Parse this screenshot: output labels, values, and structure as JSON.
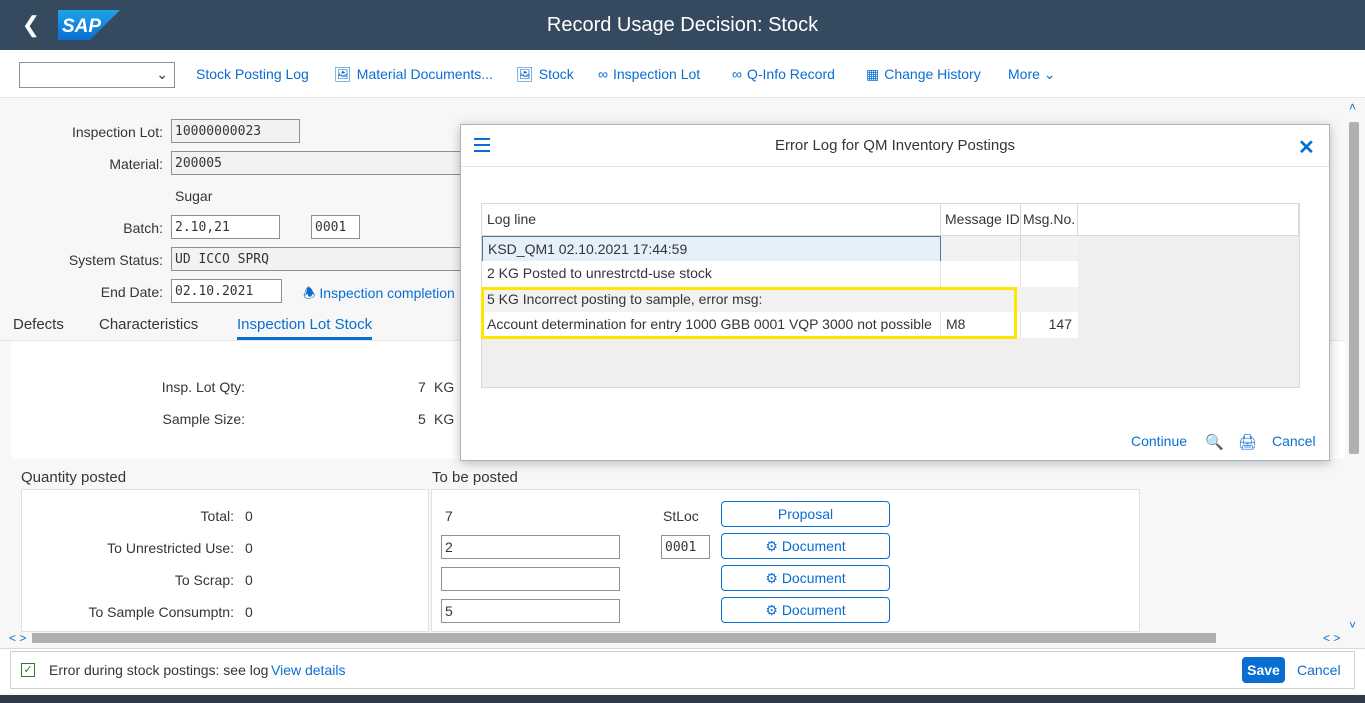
{
  "shell": {
    "title": "Record Usage Decision: Stock",
    "logo_text": "SAP"
  },
  "toolbar": {
    "items": [
      {
        "label": "Stock Posting Log",
        "icon": ""
      },
      {
        "label": "Material Documents...",
        "icon": "image-icon"
      },
      {
        "label": "Stock",
        "icon": "image-icon"
      },
      {
        "label": "Inspection Lot",
        "icon": "glasses-icon"
      },
      {
        "label": "Q-Info Record",
        "icon": "glasses-icon"
      },
      {
        "label": "Change History",
        "icon": "history-icon"
      }
    ],
    "more_label": "More"
  },
  "form": {
    "inspection_lot_label": "Inspection Lot:",
    "inspection_lot_value": "10000000023",
    "material_label": "Material:",
    "material_value": "200005",
    "material_desc": "Sugar",
    "batch_label": "Batch:",
    "batch_value": "2.10,21",
    "batch_extra": "0001",
    "system_status_label": "System Status:",
    "system_status_value": "UD   ICCO SPRQ",
    "end_date_label": "End Date:",
    "end_date_value": "02.10.2021",
    "inspection_completion_link": "Inspection completion"
  },
  "tabs": [
    {
      "label": "Defects"
    },
    {
      "label": "Characteristics"
    },
    {
      "label": "Inspection Lot Stock"
    }
  ],
  "stock": {
    "insp_lot_qty_label": "Insp. Lot Qty:",
    "insp_lot_qty_value": "7",
    "insp_lot_qty_unit": "KG",
    "sample_size_label": "Sample Size:",
    "sample_size_value": "5",
    "sample_size_unit": "KG"
  },
  "quantity_posted": {
    "title": "Quantity posted",
    "rows": [
      {
        "label": "Total:",
        "value": "0"
      },
      {
        "label": "To Unrestricted Use:",
        "value": "0"
      },
      {
        "label": "To Scrap:",
        "value": "0"
      },
      {
        "label": "To Sample Consumptn:",
        "value": "0"
      }
    ]
  },
  "to_be_posted": {
    "title": "To be posted",
    "total_value": "7",
    "stloc_label": "StLoc",
    "unrestricted_value": "2",
    "stloc_value": "0001",
    "scrap_value": "",
    "sample_value": "5",
    "proposal_label": "Proposal",
    "document_label": "Document"
  },
  "footer": {
    "message": "Error during stock postings: see log",
    "view_details": "View details",
    "save_label": "Save",
    "cancel_label": "Cancel"
  },
  "dialog": {
    "title": "Error Log for QM Inventory Postings",
    "columns": [
      "Log line",
      "Message ID",
      "Msg.No."
    ],
    "rows": [
      {
        "log": "KSD_QM1 02.10.2021 17:44:59",
        "msgid": "",
        "msgno": ""
      },
      {
        "log": "2 KG Posted to unrestrctd-use stock",
        "msgid": "",
        "msgno": ""
      },
      {
        "log": "5 KG Incorrect posting to sample, error msg:",
        "msgid": "",
        "msgno": ""
      },
      {
        "log": "Account determination for entry 1000 GBB 0001 VQP 3000 not possible",
        "msgid": "M8",
        "msgno": "147"
      }
    ],
    "continue_label": "Continue",
    "cancel_label": "Cancel"
  },
  "colors": {
    "shell": "#354a5f",
    "accent": "#0a6ed1",
    "highlight": "#ffe600",
    "success": "#2b7d2b"
  }
}
